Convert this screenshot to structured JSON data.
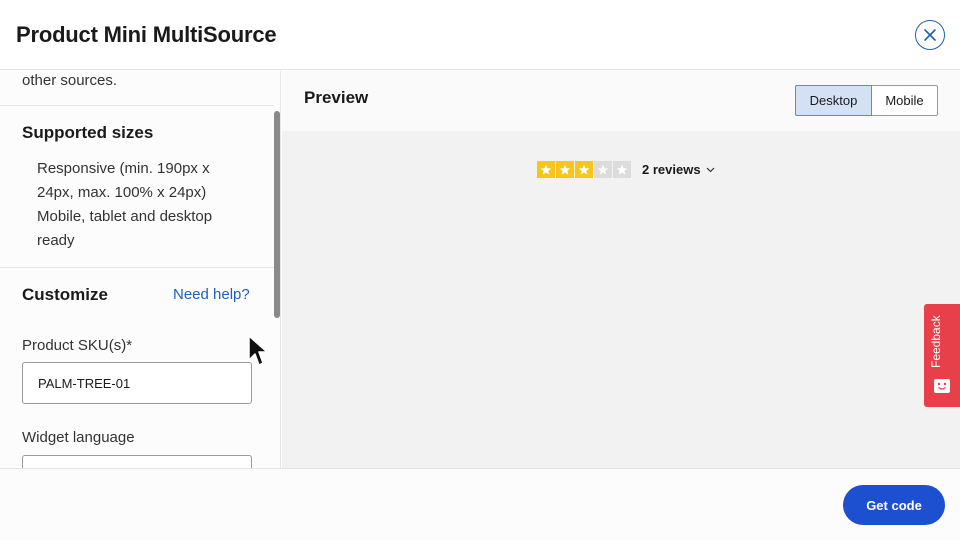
{
  "header": {
    "title": "Product Mini MultiSource",
    "close_icon": "close-circle-icon"
  },
  "sidebar": {
    "cut_text": "other sources.",
    "supported_sizes": {
      "title": "Supported sizes",
      "items": [
        "Responsive (min. 190px x 24px, max. 100% x 24px)",
        "Mobile, tablet and desktop ready"
      ]
    },
    "customize": {
      "title": "Customize",
      "help_link": "Need help?"
    },
    "sku_field": {
      "label": "Product SKU(s)*",
      "value": "PALM-TREE-01"
    },
    "language_field": {
      "label": "Widget language",
      "value": ""
    }
  },
  "preview": {
    "title": "Preview",
    "toggle": {
      "options": [
        "Desktop",
        "Mobile"
      ],
      "selected": "Desktop"
    },
    "widget": {
      "rating_stars": 3,
      "max_stars": 5,
      "reviews_label": "2 reviews",
      "star_on_color": "#f6c719",
      "star_off_color": "#dcdcdc"
    }
  },
  "footer": {
    "get_code_label": "Get code"
  },
  "feedback": {
    "label": "Feedback",
    "color": "#e8404a"
  },
  "colors": {
    "accent": "#1d4fd1",
    "link": "#1f5fb8"
  }
}
